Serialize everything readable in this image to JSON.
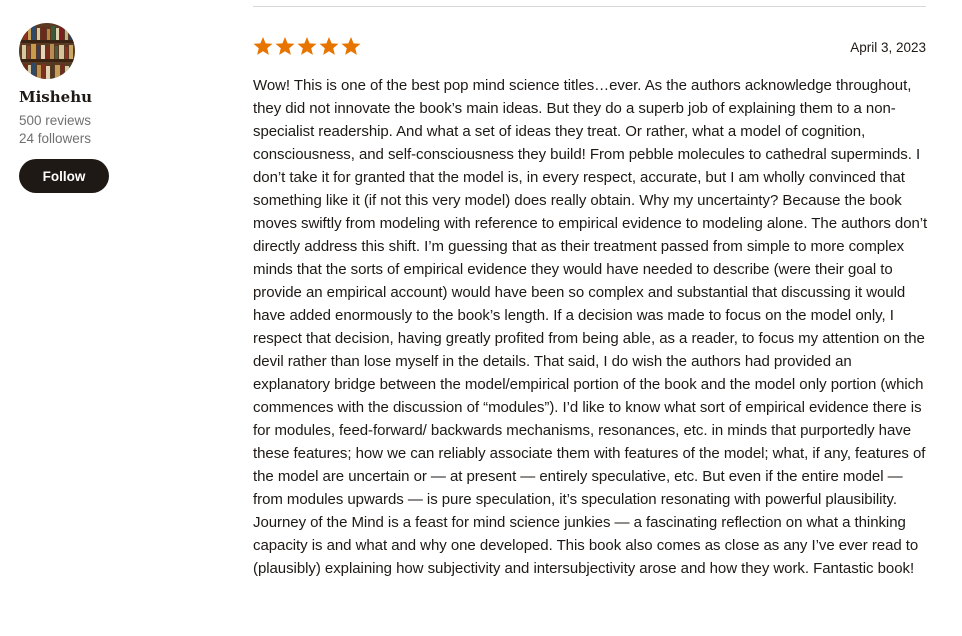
{
  "reviewer": {
    "name": "Mishehu",
    "reviews": "500 reviews",
    "followers": "24 followers",
    "follow_label": "Follow",
    "avatar_icon": "bookshelf-avatar-icon"
  },
  "review": {
    "rating": 5,
    "rating_max": 5,
    "star_color": "#e87400",
    "date": "April 3, 2023",
    "text": "Wow! This is one of the best pop mind science titles…ever. As the authors acknowledge throughout, they did not innovate the book’s main ideas. But they do a superb job of explaining them to a non-specialist readership. And what a set of ideas they treat. Or rather, what a model of cognition, consciousness, and self-consciousness they build! From pebble molecules to cathedral superminds. I don’t take it for granted that the model is, in every respect, accurate, but I am wholly convinced that something like it (if not this very model) does really obtain. Why my uncertainty? Because the book moves swiftly from modeling with reference to empirical evidence to modeling alone. The authors don’t directly address this shift. I’m guessing that as their treatment passed from simple to more complex minds that the sorts of empirical evidence they would have needed to describe (were their goal to provide an empirical account) would have been so complex and substantial that discussing it would have added enormously to the book’s length. If a decision was made to focus on the model only, I respect that decision, having greatly profited from being able, as a reader, to focus my attention on the devil rather than lose myself in the details. That said, I do wish the authors had provided an explanatory bridge between the model/empirical portion of the book and the model only portion (which commences with the discussion of “modules”). I’d like to know what sort of empirical evidence there is for modules, feed-forward/ backwards mechanisms, resonances, etc. in minds that purportedly have these features; how we can reliably associate them with features of the model; what, if any, features of the model are uncertain or — at present — entirely speculative, etc. But even if the entire model — from modules upwards — is pure speculation, it’s speculation resonating with powerful plausibility. Journey of the Mind is a feast for mind science junkies — a fascinating reflection on what a thinking capacity is and what and why one developed. This book also comes as close as any I’ve ever read to (plausibly) explaining how subjectivity and intersubjectivity arose and how they work. Fantastic book!"
  },
  "colors": {
    "button_bg": "#1e1915",
    "text": "#1e1915",
    "muted_text": "#707070",
    "divider": "#d8d8d8"
  }
}
